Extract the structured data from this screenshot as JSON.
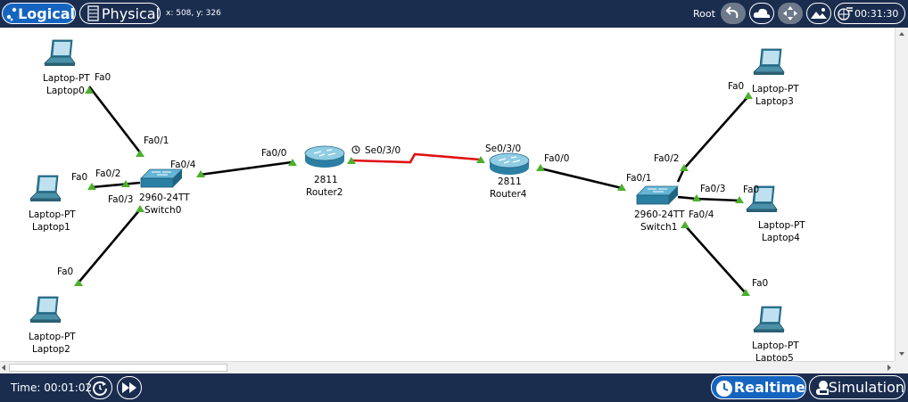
{
  "top_bar": {
    "logical_tab": "Logical",
    "physical_tab": "Physical",
    "coordinates": "x: 508, y: 326",
    "root_label": "Root",
    "clock": "00:31:30"
  },
  "devices": {
    "laptop0": {
      "type": "Laptop-PT",
      "name": "Laptop0"
    },
    "laptop1": {
      "type": "Laptop-PT",
      "name": "Laptop1"
    },
    "laptop2": {
      "type": "Laptop-PT",
      "name": "Laptop2"
    },
    "laptop3": {
      "type": "Laptop-PT",
      "name": "Laptop3"
    },
    "laptop4": {
      "type": "Laptop-PT",
      "name": "Laptop4"
    },
    "laptop5": {
      "type": "Laptop-PT",
      "name": "Laptop5"
    },
    "switch0": {
      "type": "2960-24TT",
      "name": "Switch0"
    },
    "switch1": {
      "type": "2960-24TT",
      "name": "Switch1"
    },
    "router2": {
      "type": "2811",
      "name": "Router2"
    },
    "router4": {
      "type": "2811",
      "name": "Router4"
    }
  },
  "ports": {
    "laptop0_fa0": "Fa0",
    "laptop1_fa0": "Fa0",
    "laptop2_fa0": "Fa0",
    "laptop3_fa0": "Fa0",
    "laptop4_fa0": "Fa0",
    "laptop5_fa0": "Fa0",
    "sw0_fa0_1": "Fa0/1",
    "sw0_fa0_2": "Fa0/2",
    "sw0_fa0_3": "Fa0/3",
    "sw0_fa0_4": "Fa0/4",
    "r2_fa0_0": "Fa0/0",
    "r2_se0_3_0": "Se0/3/0",
    "r4_se0_3_0": "Se0/3/0",
    "r4_fa0_0": "Fa0/0",
    "sw1_fa0_1": "Fa0/1",
    "sw1_fa0_2": "Fa0/2",
    "sw1_fa0_3": "Fa0/3",
    "sw1_fa0_4": "Fa0/4"
  },
  "link_colors": {
    "ethernet": "#000000",
    "serial": "#e01010",
    "link_up": "#4caf2e"
  },
  "bottom_bar": {
    "time": "Time: 00:01:02",
    "realtime_tab": "Realtime",
    "simulation_tab": "Simulation"
  },
  "colors": {
    "bar_bg": "#1a2d4f",
    "active_tab": "#1565c0"
  }
}
